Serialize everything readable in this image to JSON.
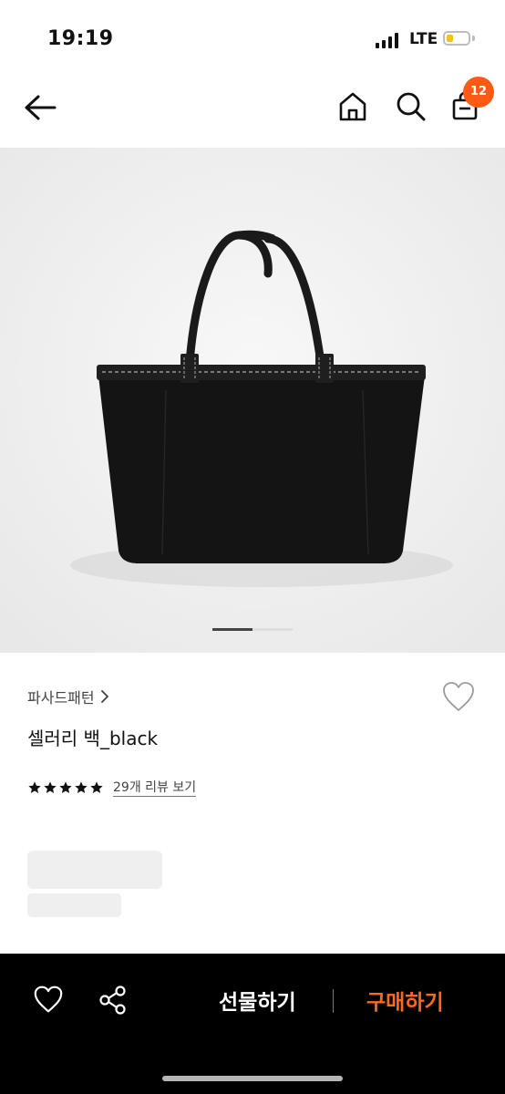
{
  "status_bar": {
    "time": "19:19",
    "network": "LTE",
    "battery_level": 0.3,
    "battery_color": "#f2c21a"
  },
  "nav": {
    "back_icon": "arrow-left-icon",
    "home_icon": "home-icon",
    "search_icon": "search-icon",
    "cart_icon": "shopping-bag-icon",
    "cart_count": "12",
    "badge_color": "#ff5a14"
  },
  "gallery": {
    "current_slide_fraction": 0.5
  },
  "product": {
    "brand": "파사드패턴",
    "name": "셀러리 백_black",
    "rating_stars": 5,
    "review_label": "29개 리뷰 보기"
  },
  "bottom_bar": {
    "gift_label": "선물하기",
    "buy_label": "구매하기",
    "buy_color": "#ff6a1a"
  }
}
